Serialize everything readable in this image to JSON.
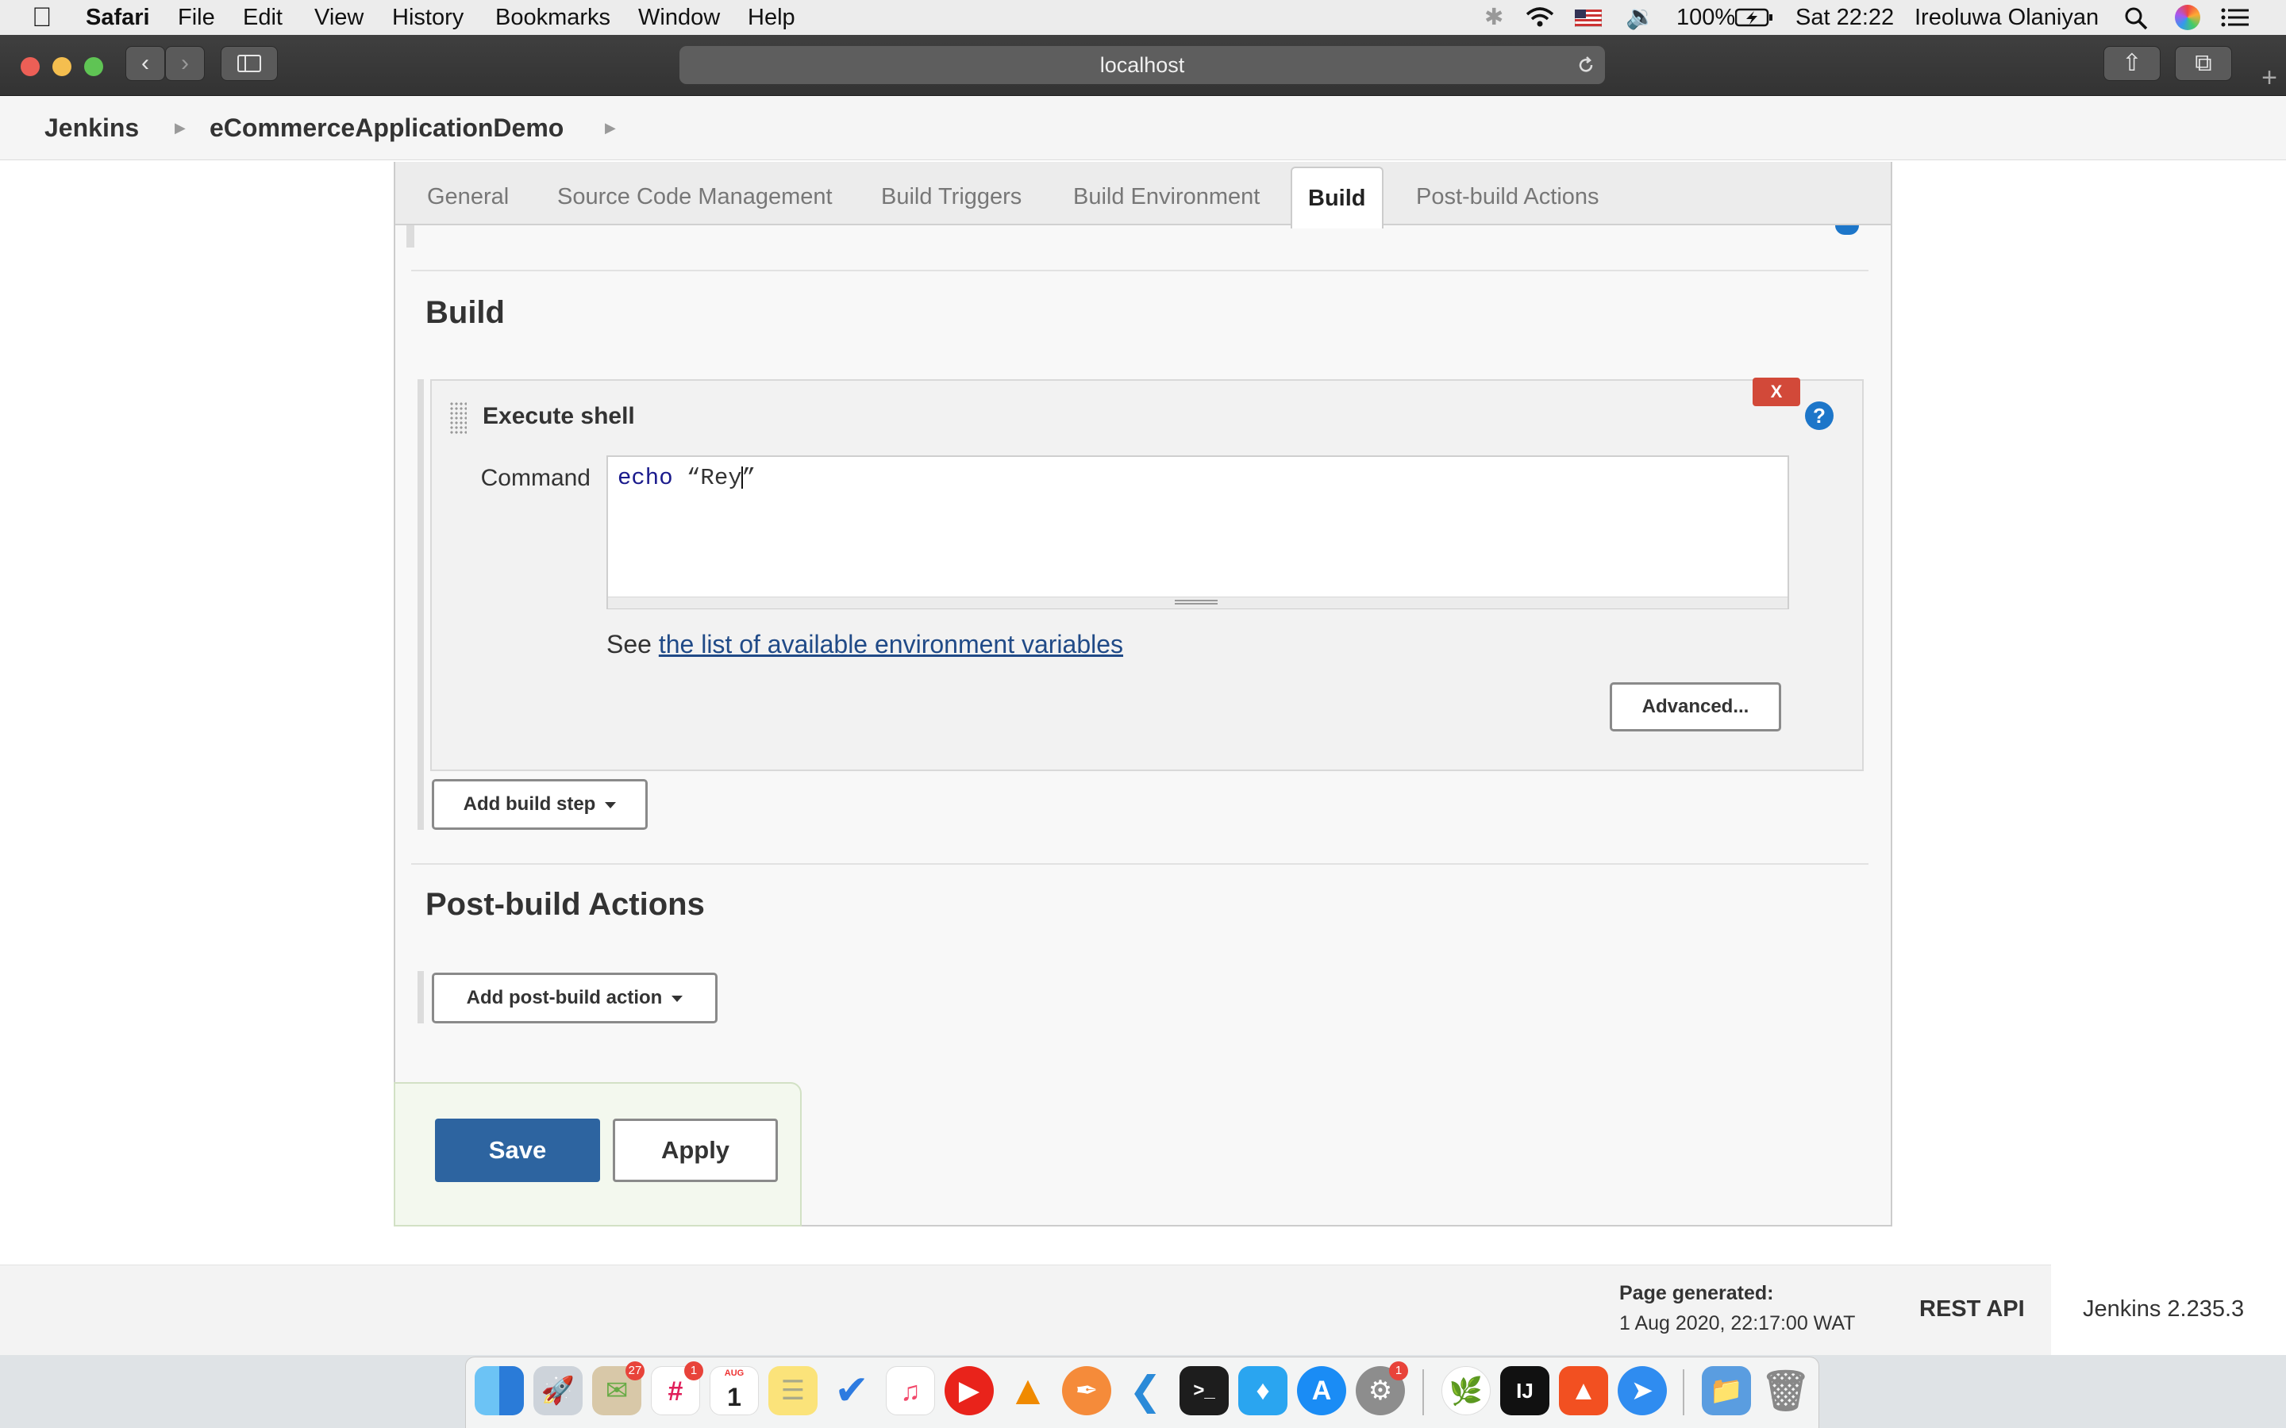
{
  "menubar": {
    "app_name": "Safari",
    "menus": [
      "File",
      "Edit",
      "View",
      "History",
      "Bookmarks",
      "Window",
      "Help"
    ],
    "battery": "100%",
    "clock": "Sat 22:22",
    "user": "Ireoluwa Olaniyan"
  },
  "browser": {
    "url": "localhost"
  },
  "breadcrumb": {
    "items": [
      "Jenkins",
      "eCommerceApplicationDemo"
    ]
  },
  "tabs": [
    "General",
    "Source Code Management",
    "Build Triggers",
    "Build Environment",
    "Build",
    "Post-build Actions"
  ],
  "active_tab": "Build",
  "build": {
    "title": "Build",
    "step_title": "Execute shell",
    "delete_label": "X",
    "help_label": "?",
    "command_label": "Command",
    "command_keyword": "echo",
    "command_before_cursor": " “Rey",
    "command_after_cursor": "”",
    "see_prefix": "See",
    "env_link": "the list of available environment variables",
    "advanced_label": "Advanced...",
    "add_step_label": "Add build step"
  },
  "post_build": {
    "title": "Post-build Actions",
    "add_action_label": "Add post-build action"
  },
  "actions": {
    "save_label": "Save",
    "apply_label": "Apply"
  },
  "footer": {
    "generated_label": "Page generated:",
    "generated_value": "1 Aug 2020, 22:17:00 WAT",
    "rest_api": "REST API",
    "version": "Jenkins 2.235.3"
  },
  "dock": {
    "badges": {
      "mail": "27",
      "slack": "1",
      "prefs": "1"
    },
    "calendar_month": "AUG",
    "calendar_day": "1"
  },
  "colors": {
    "save_button": "#2d64a0",
    "delete_button": "#d24939",
    "help_icon": "#1d76c9",
    "link": "#204a87"
  }
}
